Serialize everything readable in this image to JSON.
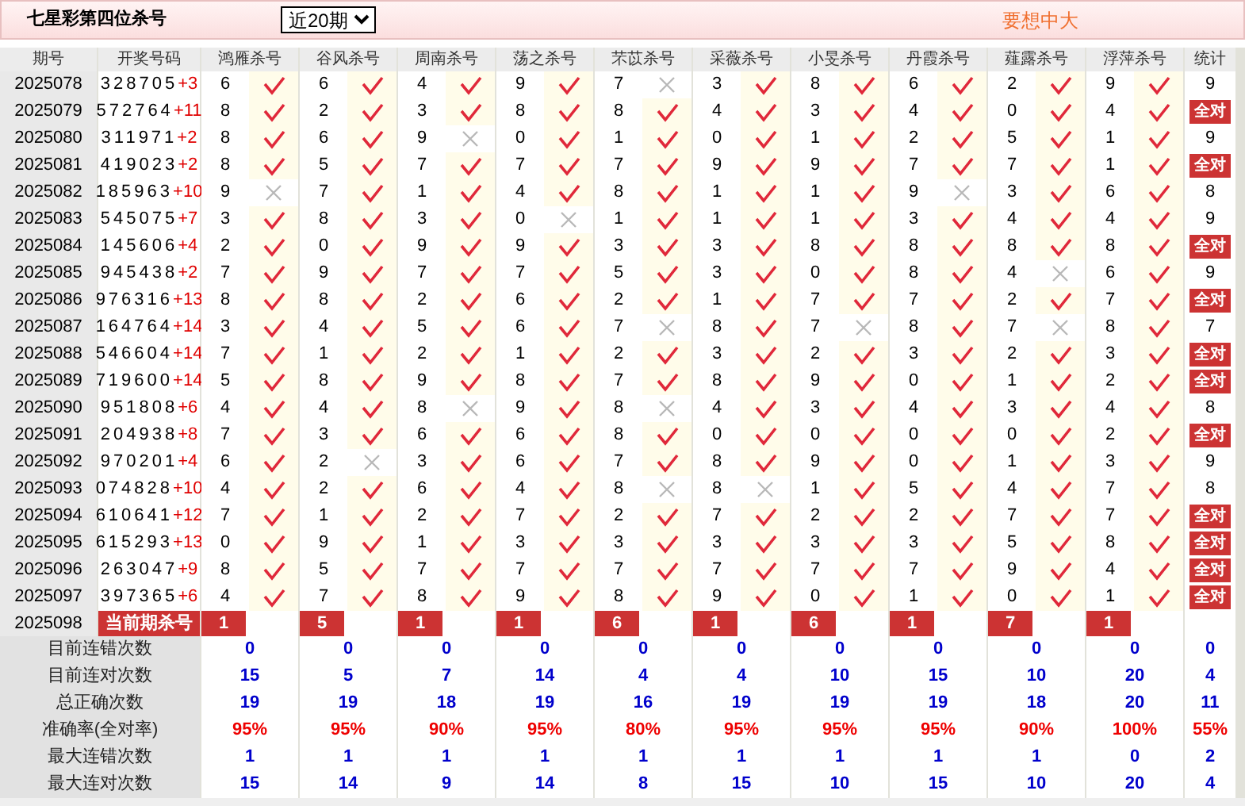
{
  "title": "七星彩第四位杀号",
  "period_select": {
    "value": "近20期"
  },
  "promo": "要想中大",
  "columns": [
    "期号",
    "开奖号码",
    "鸿雁杀号",
    "谷风杀号",
    "周南杀号",
    "荡之杀号",
    "芣苡杀号",
    "采薇杀号",
    "小旻杀号",
    "丹霞杀号",
    "薤露杀号",
    "浮萍杀号",
    "统计"
  ],
  "rows": [
    {
      "period": "2025078",
      "draw": "328705",
      "bonus": "+3",
      "kills": [
        {
          "num": "6",
          "ok": true
        },
        {
          "num": "6",
          "ok": true
        },
        {
          "num": "4",
          "ok": true
        },
        {
          "num": "9",
          "ok": true
        },
        {
          "num": "7",
          "ok": false
        },
        {
          "num": "3",
          "ok": true
        },
        {
          "num": "8",
          "ok": true
        },
        {
          "num": "6",
          "ok": true
        },
        {
          "num": "2",
          "ok": true
        },
        {
          "num": "9",
          "ok": true
        }
      ],
      "stat": {
        "text": "9",
        "highlight": false
      }
    },
    {
      "period": "2025079",
      "draw": "572764",
      "bonus": "+11",
      "kills": [
        {
          "num": "8",
          "ok": true
        },
        {
          "num": "2",
          "ok": true
        },
        {
          "num": "3",
          "ok": true
        },
        {
          "num": "8",
          "ok": true
        },
        {
          "num": "8",
          "ok": true
        },
        {
          "num": "4",
          "ok": true
        },
        {
          "num": "3",
          "ok": true
        },
        {
          "num": "4",
          "ok": true
        },
        {
          "num": "0",
          "ok": true
        },
        {
          "num": "4",
          "ok": true
        }
      ],
      "stat": {
        "text": "全对",
        "highlight": true
      }
    },
    {
      "period": "2025080",
      "draw": "311971",
      "bonus": "+2",
      "kills": [
        {
          "num": "8",
          "ok": true
        },
        {
          "num": "6",
          "ok": true
        },
        {
          "num": "9",
          "ok": false
        },
        {
          "num": "0",
          "ok": true
        },
        {
          "num": "1",
          "ok": true
        },
        {
          "num": "0",
          "ok": true
        },
        {
          "num": "1",
          "ok": true
        },
        {
          "num": "2",
          "ok": true
        },
        {
          "num": "5",
          "ok": true
        },
        {
          "num": "1",
          "ok": true
        }
      ],
      "stat": {
        "text": "9",
        "highlight": false
      }
    },
    {
      "period": "2025081",
      "draw": "419023",
      "bonus": "+2",
      "kills": [
        {
          "num": "8",
          "ok": true
        },
        {
          "num": "5",
          "ok": true
        },
        {
          "num": "7",
          "ok": true
        },
        {
          "num": "7",
          "ok": true
        },
        {
          "num": "7",
          "ok": true
        },
        {
          "num": "9",
          "ok": true
        },
        {
          "num": "9",
          "ok": true
        },
        {
          "num": "7",
          "ok": true
        },
        {
          "num": "7",
          "ok": true
        },
        {
          "num": "1",
          "ok": true
        }
      ],
      "stat": {
        "text": "全对",
        "highlight": true
      }
    },
    {
      "period": "2025082",
      "draw": "185963",
      "bonus": "+10",
      "kills": [
        {
          "num": "9",
          "ok": false
        },
        {
          "num": "7",
          "ok": true
        },
        {
          "num": "1",
          "ok": true
        },
        {
          "num": "4",
          "ok": true
        },
        {
          "num": "8",
          "ok": true
        },
        {
          "num": "1",
          "ok": true
        },
        {
          "num": "1",
          "ok": true
        },
        {
          "num": "9",
          "ok": false
        },
        {
          "num": "3",
          "ok": true
        },
        {
          "num": "6",
          "ok": true
        }
      ],
      "stat": {
        "text": "8",
        "highlight": false
      }
    },
    {
      "period": "2025083",
      "draw": "545075",
      "bonus": "+7",
      "kills": [
        {
          "num": "3",
          "ok": true
        },
        {
          "num": "8",
          "ok": true
        },
        {
          "num": "3",
          "ok": true
        },
        {
          "num": "0",
          "ok": false
        },
        {
          "num": "1",
          "ok": true
        },
        {
          "num": "1",
          "ok": true
        },
        {
          "num": "1",
          "ok": true
        },
        {
          "num": "3",
          "ok": true
        },
        {
          "num": "4",
          "ok": true
        },
        {
          "num": "4",
          "ok": true
        }
      ],
      "stat": {
        "text": "9",
        "highlight": false
      }
    },
    {
      "period": "2025084",
      "draw": "145606",
      "bonus": "+4",
      "kills": [
        {
          "num": "2",
          "ok": true
        },
        {
          "num": "0",
          "ok": true
        },
        {
          "num": "9",
          "ok": true
        },
        {
          "num": "9",
          "ok": true
        },
        {
          "num": "3",
          "ok": true
        },
        {
          "num": "3",
          "ok": true
        },
        {
          "num": "8",
          "ok": true
        },
        {
          "num": "8",
          "ok": true
        },
        {
          "num": "8",
          "ok": true
        },
        {
          "num": "8",
          "ok": true
        }
      ],
      "stat": {
        "text": "全对",
        "highlight": true
      }
    },
    {
      "period": "2025085",
      "draw": "945438",
      "bonus": "+2",
      "kills": [
        {
          "num": "7",
          "ok": true
        },
        {
          "num": "9",
          "ok": true
        },
        {
          "num": "7",
          "ok": true
        },
        {
          "num": "7",
          "ok": true
        },
        {
          "num": "5",
          "ok": true
        },
        {
          "num": "3",
          "ok": true
        },
        {
          "num": "0",
          "ok": true
        },
        {
          "num": "8",
          "ok": true
        },
        {
          "num": "4",
          "ok": false
        },
        {
          "num": "6",
          "ok": true
        }
      ],
      "stat": {
        "text": "9",
        "highlight": false
      }
    },
    {
      "period": "2025086",
      "draw": "976316",
      "bonus": "+13",
      "kills": [
        {
          "num": "8",
          "ok": true
        },
        {
          "num": "8",
          "ok": true
        },
        {
          "num": "2",
          "ok": true
        },
        {
          "num": "6",
          "ok": true
        },
        {
          "num": "2",
          "ok": true
        },
        {
          "num": "1",
          "ok": true
        },
        {
          "num": "7",
          "ok": true
        },
        {
          "num": "7",
          "ok": true
        },
        {
          "num": "2",
          "ok": true
        },
        {
          "num": "7",
          "ok": true
        }
      ],
      "stat": {
        "text": "全对",
        "highlight": true
      }
    },
    {
      "period": "2025087",
      "draw": "164764",
      "bonus": "+14",
      "kills": [
        {
          "num": "3",
          "ok": true
        },
        {
          "num": "4",
          "ok": true
        },
        {
          "num": "5",
          "ok": true
        },
        {
          "num": "6",
          "ok": true
        },
        {
          "num": "7",
          "ok": false
        },
        {
          "num": "8",
          "ok": true
        },
        {
          "num": "7",
          "ok": false
        },
        {
          "num": "8",
          "ok": true
        },
        {
          "num": "7",
          "ok": false
        },
        {
          "num": "8",
          "ok": true
        }
      ],
      "stat": {
        "text": "7",
        "highlight": false
      }
    },
    {
      "period": "2025088",
      "draw": "546604",
      "bonus": "+14",
      "kills": [
        {
          "num": "7",
          "ok": true
        },
        {
          "num": "1",
          "ok": true
        },
        {
          "num": "2",
          "ok": true
        },
        {
          "num": "1",
          "ok": true
        },
        {
          "num": "2",
          "ok": true
        },
        {
          "num": "3",
          "ok": true
        },
        {
          "num": "2",
          "ok": true
        },
        {
          "num": "3",
          "ok": true
        },
        {
          "num": "2",
          "ok": true
        },
        {
          "num": "3",
          "ok": true
        }
      ],
      "stat": {
        "text": "全对",
        "highlight": true
      }
    },
    {
      "period": "2025089",
      "draw": "719600",
      "bonus": "+14",
      "kills": [
        {
          "num": "5",
          "ok": true
        },
        {
          "num": "8",
          "ok": true
        },
        {
          "num": "9",
          "ok": true
        },
        {
          "num": "8",
          "ok": true
        },
        {
          "num": "7",
          "ok": true
        },
        {
          "num": "8",
          "ok": true
        },
        {
          "num": "9",
          "ok": true
        },
        {
          "num": "0",
          "ok": true
        },
        {
          "num": "1",
          "ok": true
        },
        {
          "num": "2",
          "ok": true
        }
      ],
      "stat": {
        "text": "全对",
        "highlight": true
      }
    },
    {
      "period": "2025090",
      "draw": "951808",
      "bonus": "+6",
      "kills": [
        {
          "num": "4",
          "ok": true
        },
        {
          "num": "4",
          "ok": true
        },
        {
          "num": "8",
          "ok": false
        },
        {
          "num": "9",
          "ok": true
        },
        {
          "num": "8",
          "ok": false
        },
        {
          "num": "4",
          "ok": true
        },
        {
          "num": "3",
          "ok": true
        },
        {
          "num": "4",
          "ok": true
        },
        {
          "num": "3",
          "ok": true
        },
        {
          "num": "4",
          "ok": true
        }
      ],
      "stat": {
        "text": "8",
        "highlight": false
      }
    },
    {
      "period": "2025091",
      "draw": "204938",
      "bonus": "+8",
      "kills": [
        {
          "num": "7",
          "ok": true
        },
        {
          "num": "3",
          "ok": true
        },
        {
          "num": "6",
          "ok": true
        },
        {
          "num": "6",
          "ok": true
        },
        {
          "num": "8",
          "ok": true
        },
        {
          "num": "0",
          "ok": true
        },
        {
          "num": "0",
          "ok": true
        },
        {
          "num": "0",
          "ok": true
        },
        {
          "num": "0",
          "ok": true
        },
        {
          "num": "2",
          "ok": true
        }
      ],
      "stat": {
        "text": "全对",
        "highlight": true
      }
    },
    {
      "period": "2025092",
      "draw": "970201",
      "bonus": "+4",
      "kills": [
        {
          "num": "6",
          "ok": true
        },
        {
          "num": "2",
          "ok": false
        },
        {
          "num": "3",
          "ok": true
        },
        {
          "num": "6",
          "ok": true
        },
        {
          "num": "7",
          "ok": true
        },
        {
          "num": "8",
          "ok": true
        },
        {
          "num": "9",
          "ok": true
        },
        {
          "num": "0",
          "ok": true
        },
        {
          "num": "1",
          "ok": true
        },
        {
          "num": "3",
          "ok": true
        }
      ],
      "stat": {
        "text": "9",
        "highlight": false
      }
    },
    {
      "period": "2025093",
      "draw": "074828",
      "bonus": "+10",
      "kills": [
        {
          "num": "4",
          "ok": true
        },
        {
          "num": "2",
          "ok": true
        },
        {
          "num": "6",
          "ok": true
        },
        {
          "num": "4",
          "ok": true
        },
        {
          "num": "8",
          "ok": false
        },
        {
          "num": "8",
          "ok": false
        },
        {
          "num": "1",
          "ok": true
        },
        {
          "num": "5",
          "ok": true
        },
        {
          "num": "4",
          "ok": true
        },
        {
          "num": "7",
          "ok": true
        }
      ],
      "stat": {
        "text": "8",
        "highlight": false
      }
    },
    {
      "period": "2025094",
      "draw": "610641",
      "bonus": "+12",
      "kills": [
        {
          "num": "7",
          "ok": true
        },
        {
          "num": "1",
          "ok": true
        },
        {
          "num": "2",
          "ok": true
        },
        {
          "num": "7",
          "ok": true
        },
        {
          "num": "2",
          "ok": true
        },
        {
          "num": "7",
          "ok": true
        },
        {
          "num": "2",
          "ok": true
        },
        {
          "num": "2",
          "ok": true
        },
        {
          "num": "7",
          "ok": true
        },
        {
          "num": "7",
          "ok": true
        }
      ],
      "stat": {
        "text": "全对",
        "highlight": true
      }
    },
    {
      "period": "2025095",
      "draw": "615293",
      "bonus": "+13",
      "kills": [
        {
          "num": "0",
          "ok": true
        },
        {
          "num": "9",
          "ok": true
        },
        {
          "num": "1",
          "ok": true
        },
        {
          "num": "3",
          "ok": true
        },
        {
          "num": "3",
          "ok": true
        },
        {
          "num": "3",
          "ok": true
        },
        {
          "num": "3",
          "ok": true
        },
        {
          "num": "3",
          "ok": true
        },
        {
          "num": "5",
          "ok": true
        },
        {
          "num": "8",
          "ok": true
        }
      ],
      "stat": {
        "text": "全对",
        "highlight": true
      }
    },
    {
      "period": "2025096",
      "draw": "263047",
      "bonus": "+9",
      "kills": [
        {
          "num": "8",
          "ok": true
        },
        {
          "num": "5",
          "ok": true
        },
        {
          "num": "7",
          "ok": true
        },
        {
          "num": "7",
          "ok": true
        },
        {
          "num": "7",
          "ok": true
        },
        {
          "num": "7",
          "ok": true
        },
        {
          "num": "7",
          "ok": true
        },
        {
          "num": "7",
          "ok": true
        },
        {
          "num": "9",
          "ok": true
        },
        {
          "num": "4",
          "ok": true
        }
      ],
      "stat": {
        "text": "全对",
        "highlight": true
      }
    },
    {
      "period": "2025097",
      "draw": "397365",
      "bonus": "+6",
      "kills": [
        {
          "num": "4",
          "ok": true
        },
        {
          "num": "7",
          "ok": true
        },
        {
          "num": "8",
          "ok": true
        },
        {
          "num": "9",
          "ok": true
        },
        {
          "num": "8",
          "ok": true
        },
        {
          "num": "9",
          "ok": true
        },
        {
          "num": "0",
          "ok": true
        },
        {
          "num": "1",
          "ok": true
        },
        {
          "num": "0",
          "ok": true
        },
        {
          "num": "1",
          "ok": true
        }
      ],
      "stat": {
        "text": "全对",
        "highlight": true
      }
    }
  ],
  "current": {
    "period": "2025098",
    "label": "当前期杀号",
    "kills": [
      "1",
      "5",
      "1",
      "1",
      "6",
      "1",
      "6",
      "1",
      "7",
      "1"
    ]
  },
  "stats": [
    {
      "label": "目前连错次数",
      "color": "#0000cc",
      "values": [
        "0",
        "0",
        "0",
        "0",
        "0",
        "0",
        "0",
        "0",
        "0",
        "0",
        "0"
      ]
    },
    {
      "label": "目前连对次数",
      "color": "#0000cc",
      "values": [
        "15",
        "5",
        "7",
        "14",
        "4",
        "4",
        "10",
        "15",
        "10",
        "20",
        "4"
      ]
    },
    {
      "label": "总正确次数",
      "color": "#0000cc",
      "values": [
        "19",
        "19",
        "18",
        "19",
        "16",
        "19",
        "19",
        "19",
        "18",
        "20",
        "11"
      ]
    },
    {
      "label": "准确率(全对率)",
      "color": "#ee0000",
      "values": [
        "95%",
        "95%",
        "90%",
        "95%",
        "80%",
        "95%",
        "95%",
        "95%",
        "90%",
        "100%",
        "55%"
      ]
    },
    {
      "label": "最大连错次数",
      "color": "#0000cc",
      "values": [
        "1",
        "1",
        "1",
        "1",
        "1",
        "1",
        "1",
        "1",
        "1",
        "0",
        "2"
      ]
    },
    {
      "label": "最大连对次数",
      "color": "#0000cc",
      "values": [
        "15",
        "14",
        "9",
        "14",
        "8",
        "15",
        "10",
        "15",
        "10",
        "20",
        "4"
      ]
    }
  ]
}
